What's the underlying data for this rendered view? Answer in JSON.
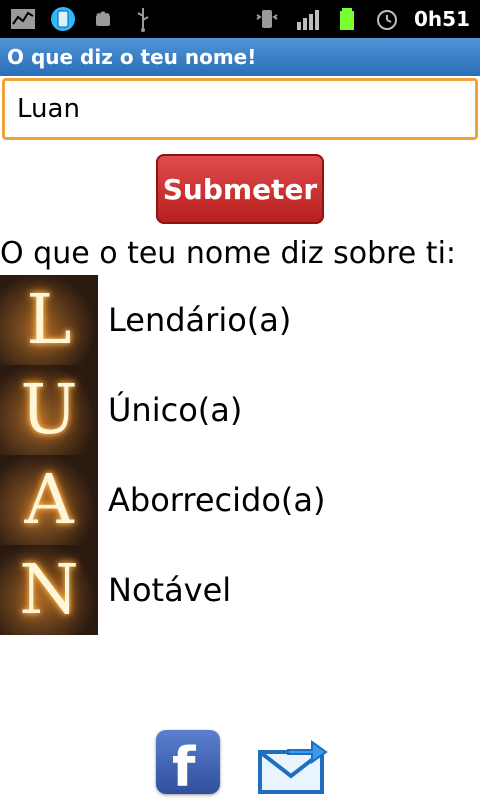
{
  "status_bar": {
    "time": "0h51",
    "icons": [
      "activity-icon",
      "phone-app-icon",
      "android-icon",
      "usb-icon",
      "vibrate-icon",
      "signal-icon",
      "battery-icon",
      "alarm-icon"
    ]
  },
  "app": {
    "title": "O que diz o teu nome!"
  },
  "form": {
    "name_value": "Luan",
    "submit_label": "Submeter"
  },
  "result": {
    "heading": "O que o teu nome diz sobre ti:",
    "items": [
      {
        "letter": "L",
        "meaning": "Lendário(a)"
      },
      {
        "letter": "U",
        "meaning": "Único(a)"
      },
      {
        "letter": "A",
        "meaning": "Aborrecido(a)"
      },
      {
        "letter": "N",
        "meaning": "Notável"
      }
    ]
  },
  "share": {
    "facebook_glyph": "f",
    "accent_facebook": "#3b5998",
    "accent_mail": "#1e6fbf"
  }
}
